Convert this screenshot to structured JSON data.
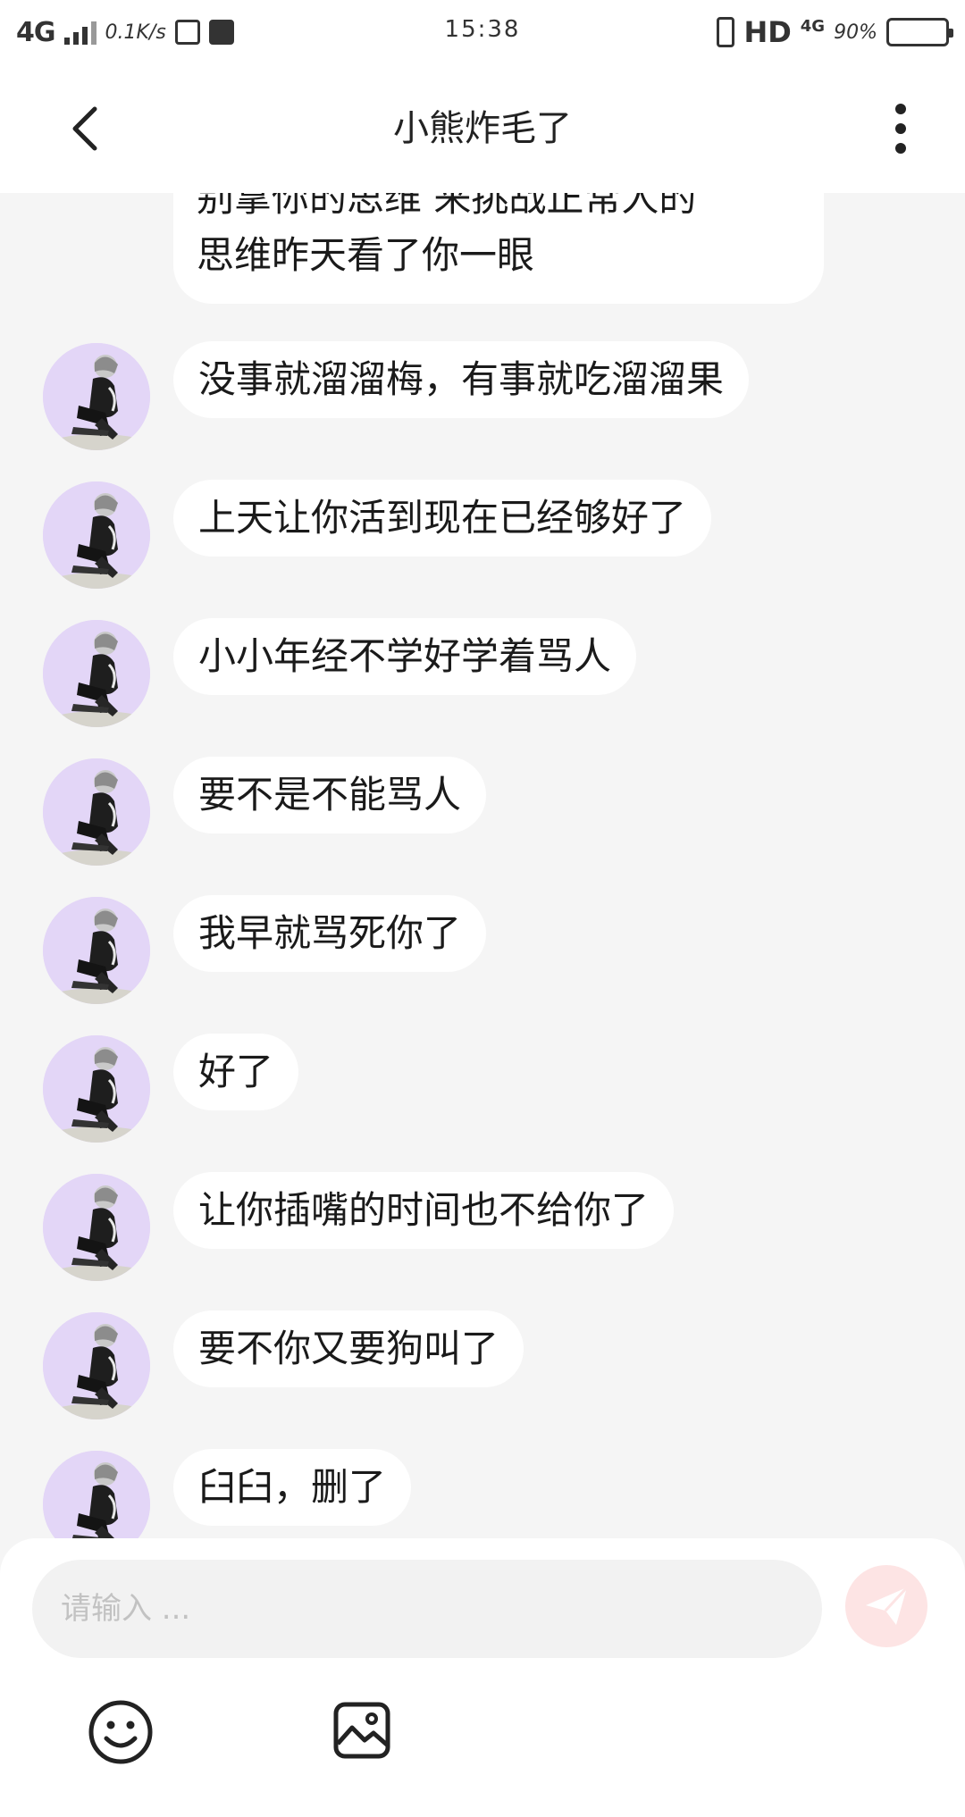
{
  "status_bar": {
    "network": "4G",
    "speed": "0.1K/s",
    "time": "15:38",
    "hd_label": "HD",
    "net_small": "4G",
    "battery_pct": "90%",
    "battery_level": 0.9,
    "battery_color": "#f4a6e6"
  },
  "header": {
    "title": "小熊炸毛了",
    "back_icon": "chevron-left-icon",
    "more_icon": "more-vertical-icon"
  },
  "chat": {
    "partial_message": {
      "lines": [
        "别拿你的思维 来挑战正常人的",
        "思维昨天看了你一眼"
      ]
    },
    "messages": [
      {
        "text": "没事就溜溜梅，有事就吃溜溜果"
      },
      {
        "text": "上天让你活到现在已经够好了"
      },
      {
        "text": "小小年经不学好学着骂人"
      },
      {
        "text": "要不是不能骂人"
      },
      {
        "text": "我早就骂死你了"
      },
      {
        "text": "好了"
      },
      {
        "text": "让你插嘴的时间也不给你了"
      },
      {
        "text": "要不你又要狗叫了"
      },
      {
        "text": "臼臼，删了"
      }
    ]
  },
  "input": {
    "placeholder": "请输入 ...",
    "value": "",
    "send_icon": "send-icon",
    "emoji_icon": "emoji-icon",
    "image_icon": "image-icon"
  },
  "colors": {
    "background": "#f5f5f5",
    "bubble": "#ffffff",
    "avatar_bg": "#e3d6f7",
    "send_bg": "#fde4e4",
    "send_icon": "#ffffff"
  }
}
